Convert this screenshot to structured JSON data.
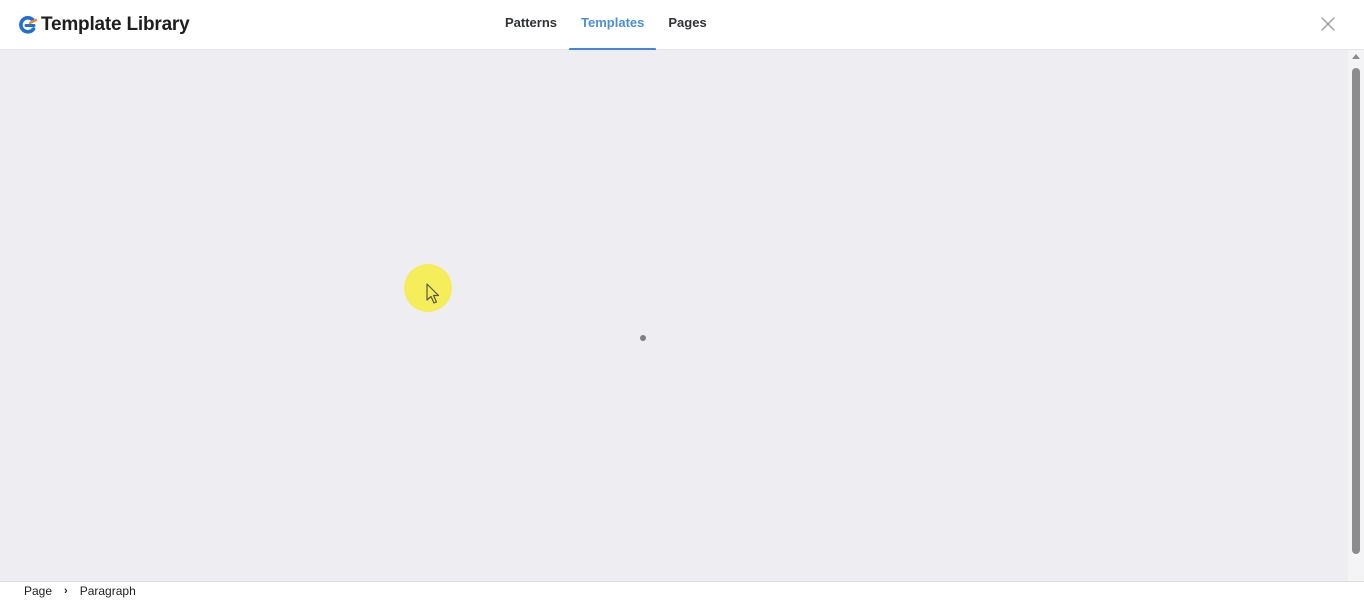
{
  "header": {
    "brand_title": "Template Library",
    "logo_icon": "brand-logo-icon",
    "tabs": [
      {
        "label": "Patterns",
        "active": false
      },
      {
        "label": "Templates",
        "active": true
      },
      {
        "label": "Pages",
        "active": false
      }
    ],
    "close_icon": "close-icon"
  },
  "content": {
    "state": "loading"
  },
  "footer": {
    "breadcrumb": [
      "Page",
      "Paragraph"
    ],
    "separator_icon": "chevron-right-icon"
  },
  "colors": {
    "accent": "#3f86e0",
    "active_tab_text": "#4a90d9",
    "content_bg": "#eeeef2",
    "cursor_highlight": "#f6ec4a"
  }
}
